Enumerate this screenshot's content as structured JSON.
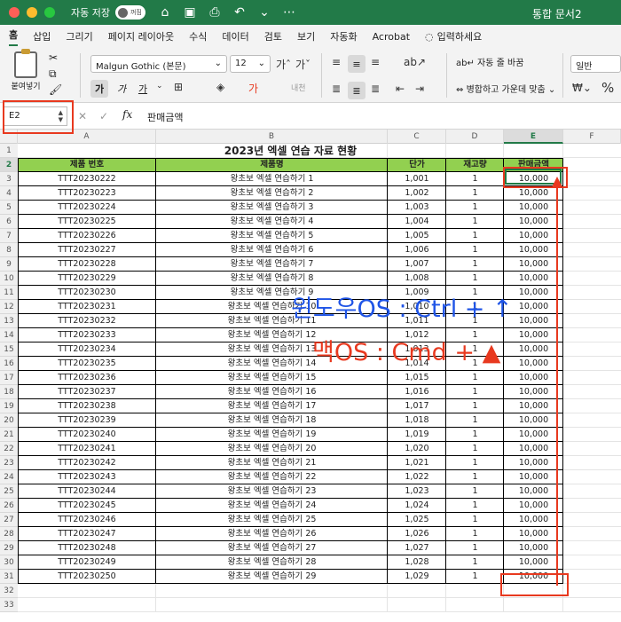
{
  "titlebar": {
    "autosave_label": "자동 저장",
    "autosave_state": "꺼짐",
    "doc_title": "통합 문서2"
  },
  "tabs": [
    "홈",
    "삽입",
    "그리기",
    "페이지 레이아웃",
    "수식",
    "데이터",
    "검토",
    "보기",
    "자동화",
    "Acrobat"
  ],
  "active_tab": "홈",
  "tell_me": "입력하세요",
  "ribbon": {
    "paste_label": "붙여넣기",
    "font_name": "Malgun Gothic (본문)",
    "font_size": "12",
    "bold": "가",
    "italic": "가",
    "underline": "가",
    "wrap_text": "자동 줄 바꿈",
    "merge_center": "병합하고 가운데 맞춤",
    "number_format": "일반",
    "percent": "%"
  },
  "formula_bar": {
    "name_box": "E2",
    "fx": "fx",
    "content": "판매금액"
  },
  "sheet": {
    "columns": [
      "A",
      "B",
      "C",
      "D",
      "E",
      "F"
    ],
    "selected_column": "E",
    "selected_row": "2",
    "row_count": 33,
    "title": "2023년 엑셀 연습 자료 현황",
    "headers": [
      "제품 번호",
      "제품명",
      "단가",
      "재고량",
      "판매금액"
    ],
    "rows": [
      [
        "TTT20230222",
        "왕초보 엑셀 연습하기 1",
        "1,001",
        "1",
        "10,000"
      ],
      [
        "TTT20230223",
        "왕초보 엑셀 연습하기 2",
        "1,002",
        "1",
        "10,000"
      ],
      [
        "TTT20230224",
        "왕초보 엑셀 연습하기 3",
        "1,003",
        "1",
        "10,000"
      ],
      [
        "TTT20230225",
        "왕초보 엑셀 연습하기 4",
        "1,004",
        "1",
        "10,000"
      ],
      [
        "TTT20230226",
        "왕초보 엑셀 연습하기 5",
        "1,005",
        "1",
        "10,000"
      ],
      [
        "TTT20230227",
        "왕초보 엑셀 연습하기 6",
        "1,006",
        "1",
        "10,000"
      ],
      [
        "TTT20230228",
        "왕초보 엑셀 연습하기 7",
        "1,007",
        "1",
        "10,000"
      ],
      [
        "TTT20230229",
        "왕초보 엑셀 연습하기 8",
        "1,008",
        "1",
        "10,000"
      ],
      [
        "TTT20230230",
        "왕초보 엑셀 연습하기 9",
        "1,009",
        "1",
        "10,000"
      ],
      [
        "TTT20230231",
        "왕초보 엑셀 연습하기 10",
        "1,010",
        "1",
        "10,000"
      ],
      [
        "TTT20230232",
        "왕초보 엑셀 연습하기 11",
        "1,011",
        "1",
        "10,000"
      ],
      [
        "TTT20230233",
        "왕초보 엑셀 연습하기 12",
        "1,012",
        "1",
        "10,000"
      ],
      [
        "TTT20230234",
        "왕초보 엑셀 연습하기 13",
        "1,013",
        "1",
        "10,000"
      ],
      [
        "TTT20230235",
        "왕초보 엑셀 연습하기 14",
        "1,014",
        "1",
        "10,000"
      ],
      [
        "TTT20230236",
        "왕초보 엑셀 연습하기 15",
        "1,015",
        "1",
        "10,000"
      ],
      [
        "TTT20230237",
        "왕초보 엑셀 연습하기 16",
        "1,016",
        "1",
        "10,000"
      ],
      [
        "TTT20230238",
        "왕초보 엑셀 연습하기 17",
        "1,017",
        "1",
        "10,000"
      ],
      [
        "TTT20230239",
        "왕초보 엑셀 연습하기 18",
        "1,018",
        "1",
        "10,000"
      ],
      [
        "TTT20230240",
        "왕초보 엑셀 연습하기 19",
        "1,019",
        "1",
        "10,000"
      ],
      [
        "TTT20230241",
        "왕초보 엑셀 연습하기 20",
        "1,020",
        "1",
        "10,000"
      ],
      [
        "TTT20230242",
        "왕초보 엑셀 연습하기 21",
        "1,021",
        "1",
        "10,000"
      ],
      [
        "TTT20230243",
        "왕초보 엑셀 연습하기 22",
        "1,022",
        "1",
        "10,000"
      ],
      [
        "TTT20230244",
        "왕초보 엑셀 연습하기 23",
        "1,023",
        "1",
        "10,000"
      ],
      [
        "TTT20230245",
        "왕초보 엑셀 연습하기 24",
        "1,024",
        "1",
        "10,000"
      ],
      [
        "TTT20230246",
        "왕초보 엑셀 연습하기 25",
        "1,025",
        "1",
        "10,000"
      ],
      [
        "TTT20230247",
        "왕초보 엑셀 연습하기 26",
        "1,026",
        "1",
        "10,000"
      ],
      [
        "TTT20230248",
        "왕초보 엑셀 연습하기 27",
        "1,027",
        "1",
        "10,000"
      ],
      [
        "TTT20230249",
        "왕초보 엑셀 연습하기 28",
        "1,028",
        "1",
        "10,000"
      ],
      [
        "TTT20230250",
        "왕초보 엑셀 연습하기 29",
        "1,029",
        "1",
        "10,000"
      ]
    ]
  },
  "annotations": {
    "windows_shortcut": "윈도우OS : Ctrl + ↑",
    "mac_shortcut": "맥OS : Cmd + ▲"
  },
  "colors": {
    "excel_green": "#227a48",
    "header_fill": "#92d050",
    "highlight_red": "#e8391f",
    "note_blue": "#1f54e6"
  }
}
